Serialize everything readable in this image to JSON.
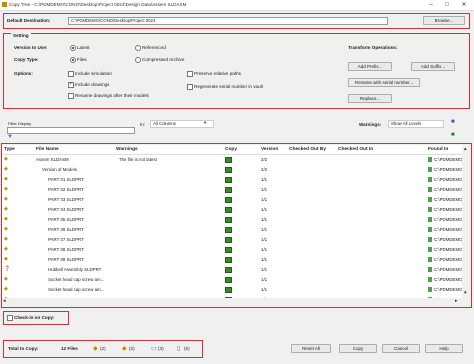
{
  "window": {
    "title": "Copy Tree - C:\\PDMDEMO\\CONO\\Desktop\\Project 0024\\Design Data\\Assem SLDASM",
    "min_glyph": "–",
    "max_glyph": "□",
    "close_glyph": "✕"
  },
  "destination": {
    "label": "Default Destination:",
    "value": "C:\\PDMDEMO\\CONO\\Desktop\\Project 0024",
    "browse_label": "Browse..."
  },
  "settings": {
    "header": "Setting",
    "version_label": "Version to Use:",
    "version_options": [
      "Latest",
      "Referenced"
    ],
    "copy_type_label": "Copy Type:",
    "copy_type_options": [
      "Files",
      "Compressed Archive"
    ],
    "options_label": "Options:",
    "option_items": [
      "Include simulation",
      "Include drawings",
      "Rename drawings after their models",
      "Preserve relative paths",
      "Regenerate serial number in vault"
    ],
    "transform_label": "Transform Operations:",
    "add_prefix": "Add Prefix...",
    "add_suffix": "Add Suffix...",
    "rename_serial": "Rename with serial number...",
    "replace": "Replace..."
  },
  "filterbar": {
    "filter_label": "Filter Display",
    "in_label": "In:",
    "columns_value": "All Columns",
    "warnings_label": "Warnings:",
    "warnings_value": "Show All Levels"
  },
  "grid": {
    "headers": {
      "type": "Type",
      "file_name": "File Name",
      "warnings": "Warnings",
      "copy": "Copy",
      "version": "Version",
      "checked_out_by": "Checked Out By",
      "checked_out_in": "Checked Out In",
      "found_in": "Found In"
    },
    "rows": [
      {
        "name": "Assem SLDASM",
        "warning": "The file is not latest",
        "version": "2/2",
        "found": "C:\\PDMDEMO\\CONO\\"
      },
      {
        "name": "Version of Models",
        "warning": "",
        "version": "2/2",
        "found": "C:\\PDMDEMO\\CONO\\"
      },
      {
        "name": "PART 01 SLDPRT",
        "warning": "",
        "version": "1/1",
        "found": "C:\\PDMDEMO\\CONO\\"
      },
      {
        "name": "PART 02 SLDPRT",
        "warning": "",
        "version": "1/1",
        "found": "C:\\PDMDEMO\\CONO\\"
      },
      {
        "name": "PART 03 SLDPRT",
        "warning": "",
        "version": "1/1",
        "found": "C:\\PDMDEMO\\CONO\\"
      },
      {
        "name": "PART 04 SLDPRT",
        "warning": "",
        "version": "1/1",
        "found": "C:\\PDMDEMO\\CONO\\"
      },
      {
        "name": "PART 05 SLDPRT",
        "warning": "",
        "version": "1/1",
        "found": "C:\\PDMDEMO\\CONO\\"
      },
      {
        "name": "PART 06 SLDPRT",
        "warning": "",
        "version": "1/1",
        "found": "C:\\PDMDEMO\\CONO\\"
      },
      {
        "name": "PART 07 SLDPRT",
        "warning": "",
        "version": "1/1",
        "found": "C:\\PDMDEMO\\CONO\\"
      },
      {
        "name": "PART 08 SLDPRT",
        "warning": "",
        "version": "1/1",
        "found": "C:\\PDMDEMO\\CONO\\"
      },
      {
        "name": "PART 09 SLDPRT",
        "warning": "",
        "version": "1/1",
        "found": "C:\\PDMDEMO\\CONO\\"
      },
      {
        "name": "Hubbell Assembly SLDPRT",
        "warning": "",
        "version": "1/1",
        "found": "C:\\PDMDEMO\\CONO\\"
      },
      {
        "name": "Socket head cap screw am...",
        "warning": "",
        "version": "1/1",
        "found": "C:\\PDMDEMO\\CONO\\"
      },
      {
        "name": "Socket head cap screw am...",
        "warning": "",
        "version": "1/1",
        "found": "C:\\PDMDEMO\\CONO\\"
      },
      {
        "name": "PART 10 SLDPRT",
        "warning": "",
        "version": "1/1",
        "found": "C:\\PDMDEMO\\CONO\\"
      }
    ]
  },
  "checkin": {
    "label": "Check-in on Copy:"
  },
  "footer": {
    "total_label": "Total to Copy:",
    "files_count": "12 Files",
    "counts": [
      "(2)",
      "(2)",
      "(3)",
      "(5)"
    ],
    "reset_all": "Reset All",
    "copy": "Copy",
    "cancel": "Cancel",
    "help": "Help"
  },
  "colors": {
    "highlight": "#d62c3c",
    "accent_green": "#3a8a2a"
  }
}
